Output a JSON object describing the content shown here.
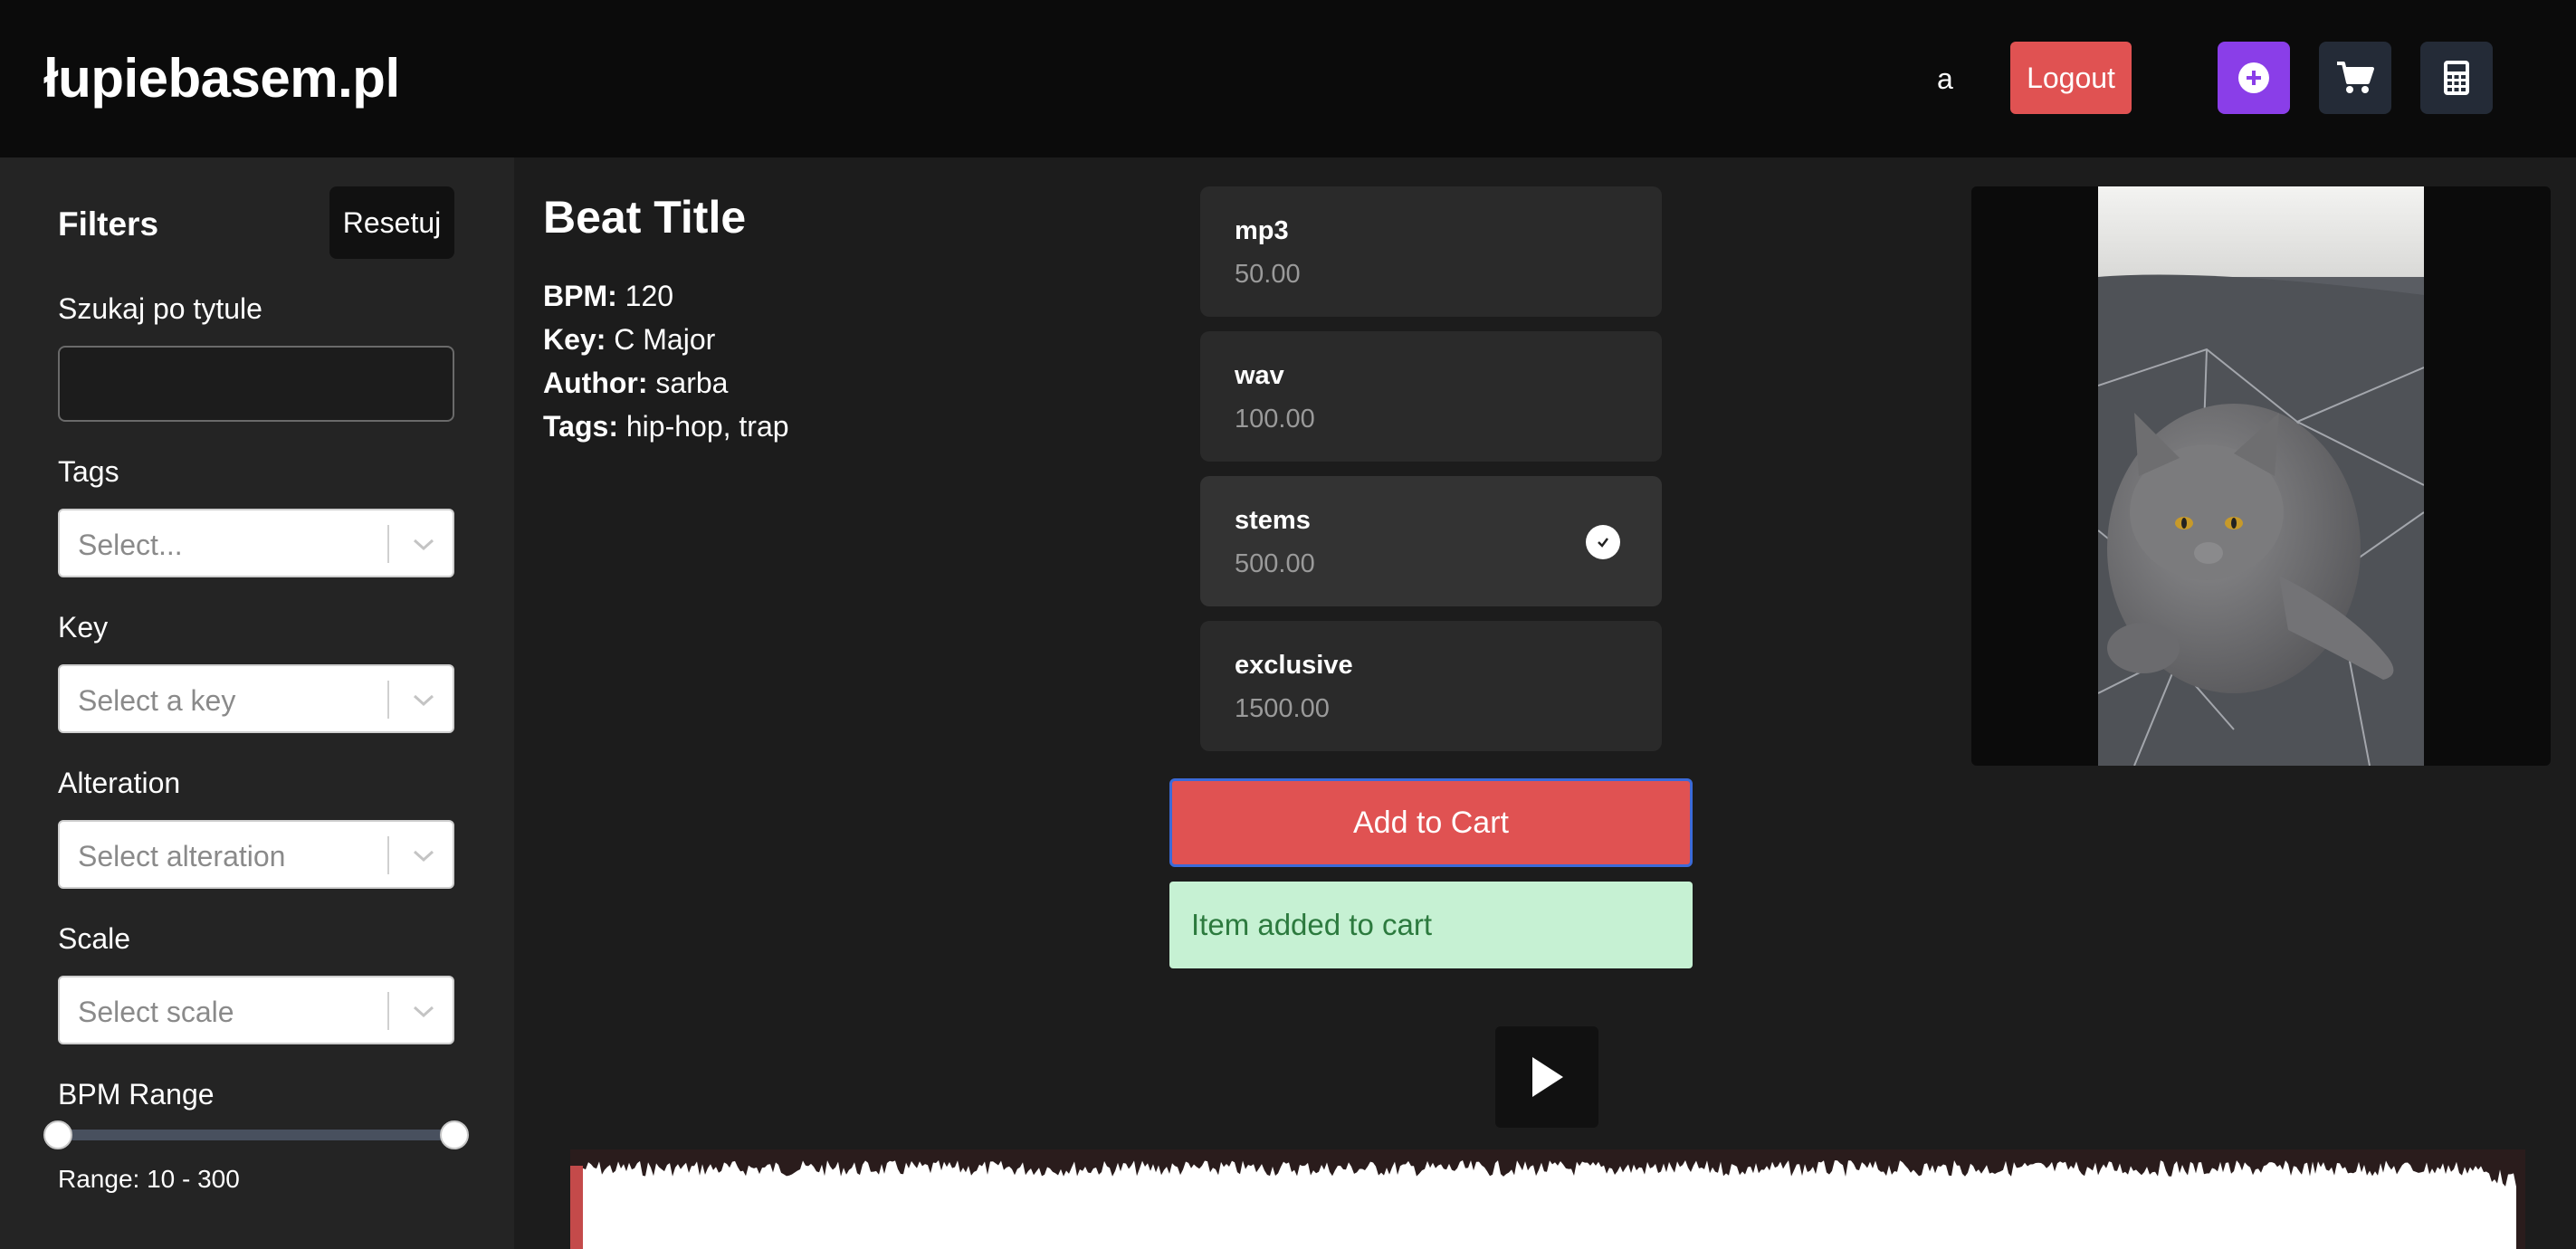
{
  "header": {
    "logo": "łupiebasem.pl",
    "user": "a",
    "logout_label": "Logout"
  },
  "sidebar": {
    "title": "Filters",
    "reset_label": "Resetuj",
    "search_label": "Szukaj po tytule",
    "search_value": "",
    "tags_label": "Tags",
    "tags_placeholder": "Select...",
    "key_label": "Key",
    "key_placeholder": "Select a key",
    "alteration_label": "Alteration",
    "alteration_placeholder": "Select alteration",
    "scale_label": "Scale",
    "scale_placeholder": "Select scale",
    "bpm_label": "BPM Range",
    "bpm_min": 10,
    "bpm_max": 300,
    "range_text": "Range: 10 - 300"
  },
  "beat": {
    "title": "Beat Title",
    "bpm_label": "BPM:",
    "bpm_value": "120",
    "key_label": "Key:",
    "key_value": "C Major",
    "author_label": "Author:",
    "author_value": "sarba",
    "tags_label": "Tags:",
    "tags_value": "hip-hop, trap"
  },
  "licenses": [
    {
      "name": "mp3",
      "price": "50.00",
      "selected": false
    },
    {
      "name": "wav",
      "price": "100.00",
      "selected": false
    },
    {
      "name": "stems",
      "price": "500.00",
      "selected": true
    },
    {
      "name": "exclusive",
      "price": "1500.00",
      "selected": false
    }
  ],
  "add_to_cart_label": "Add to Cart",
  "success_message": "Item added to cart",
  "colors": {
    "accent_red": "#e05252",
    "accent_purple": "#8a3ee8",
    "success_bg": "#c6f1d3",
    "success_text": "#2c7a3e"
  }
}
